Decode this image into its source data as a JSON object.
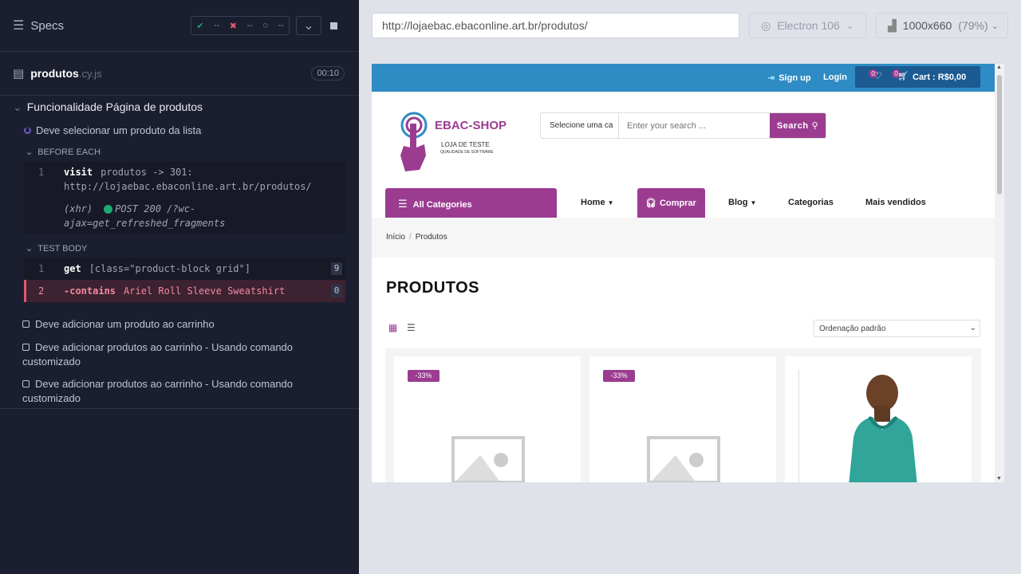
{
  "reporter": {
    "specs_label": "Specs",
    "stats": {
      "passed": "--",
      "failed": "--",
      "pending": "--"
    },
    "file": {
      "name": "produtos",
      "ext": ".cy.js",
      "duration": "00:10"
    },
    "suite_title": "Funcionalidade Página de produtos",
    "active_test": "Deve selecionar um produto da lista",
    "before_each_label": "BEFORE EACH",
    "before_cmds": [
      {
        "num": "1",
        "name": "visit",
        "arg": "produtos -> 301: http://lojaebac.ebaconline.art.br/produtos/"
      }
    ],
    "xhr": {
      "tag": "(xhr)",
      "text": "POST 200 /?wc-ajax=get_refreshed_fragments"
    },
    "test_body_label": "TEST BODY",
    "body_cmds": [
      {
        "num": "1",
        "name": "get",
        "arg": "[class=\"product-block grid\"]",
        "badge": "9"
      },
      {
        "num": "2",
        "name": "-contains",
        "arg": "Ariel Roll Sleeve Sweatshirt",
        "badge": "0"
      }
    ],
    "other_tests": [
      "Deve adicionar um produto ao carrinho",
      "Deve adicionar produtos ao carrinho - Usando comando customizado",
      "Deve adicionar produtos ao carrinho - Usando comando customizado"
    ]
  },
  "toolbar": {
    "url": "http://lojaebac.ebaconline.art.br/produtos/",
    "browser": "Electron 106",
    "viewport": "1000x660",
    "zoom": "(79%)"
  },
  "site": {
    "signup": "Sign up",
    "login": "Login",
    "wishlist_count": "0",
    "cart_count": "0",
    "cart_label": "Cart : R$0,00",
    "logo_title": "EBAC-SHOP",
    "logo_sub": "LOJA DE TESTE",
    "logo_tiny": "QUALIDADE DE SOFTWARE",
    "search_category": "Selecione uma ca",
    "search_placeholder": "Enter your search ...",
    "search_button": "Search",
    "all_categories": "All Categories",
    "nav": {
      "home": "Home",
      "comprar": "Comprar",
      "blog": "Blog",
      "categorias": "Categorias",
      "mais": "Mais vendidos"
    },
    "breadcrumb": {
      "home": "Início",
      "current": "Produtos"
    },
    "page_title": "PRODUTOS",
    "order_select": "Ordenação padrão",
    "sale_badges": [
      "-33%",
      "-33%"
    ],
    "colors": {
      "brand": "#9b3c91",
      "topbar": "#2f8bc4"
    }
  }
}
